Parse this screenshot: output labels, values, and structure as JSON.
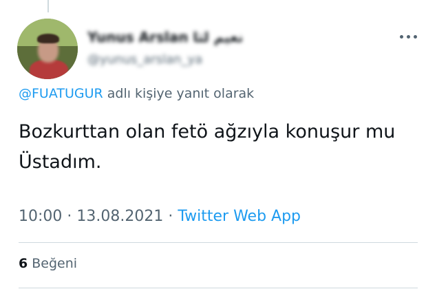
{
  "author": {
    "display_name": "Yunus Arslan نعيم لثا",
    "handle": "@yunus_arslan_ya"
  },
  "reply_context": {
    "mention": "@FUATUGUR",
    "suffix": " adlı kişiye yanıt olarak"
  },
  "tweet": {
    "text": "Bozkurttan olan fetö ağzıyla konuşur mu Üstadım."
  },
  "meta": {
    "time": "10:00",
    "separator1": " · ",
    "date": "13.08.2021",
    "separator2": " · ",
    "source": "Twitter Web App"
  },
  "engagement": {
    "likes_count": "6",
    "likes_label": " Beğeni"
  },
  "icons": {
    "more": "more-horizontal-icon"
  },
  "colors": {
    "link": "#1d9bf0",
    "secondary_text": "#536471",
    "primary_text": "#0f1419",
    "divider": "#cfd9de"
  }
}
